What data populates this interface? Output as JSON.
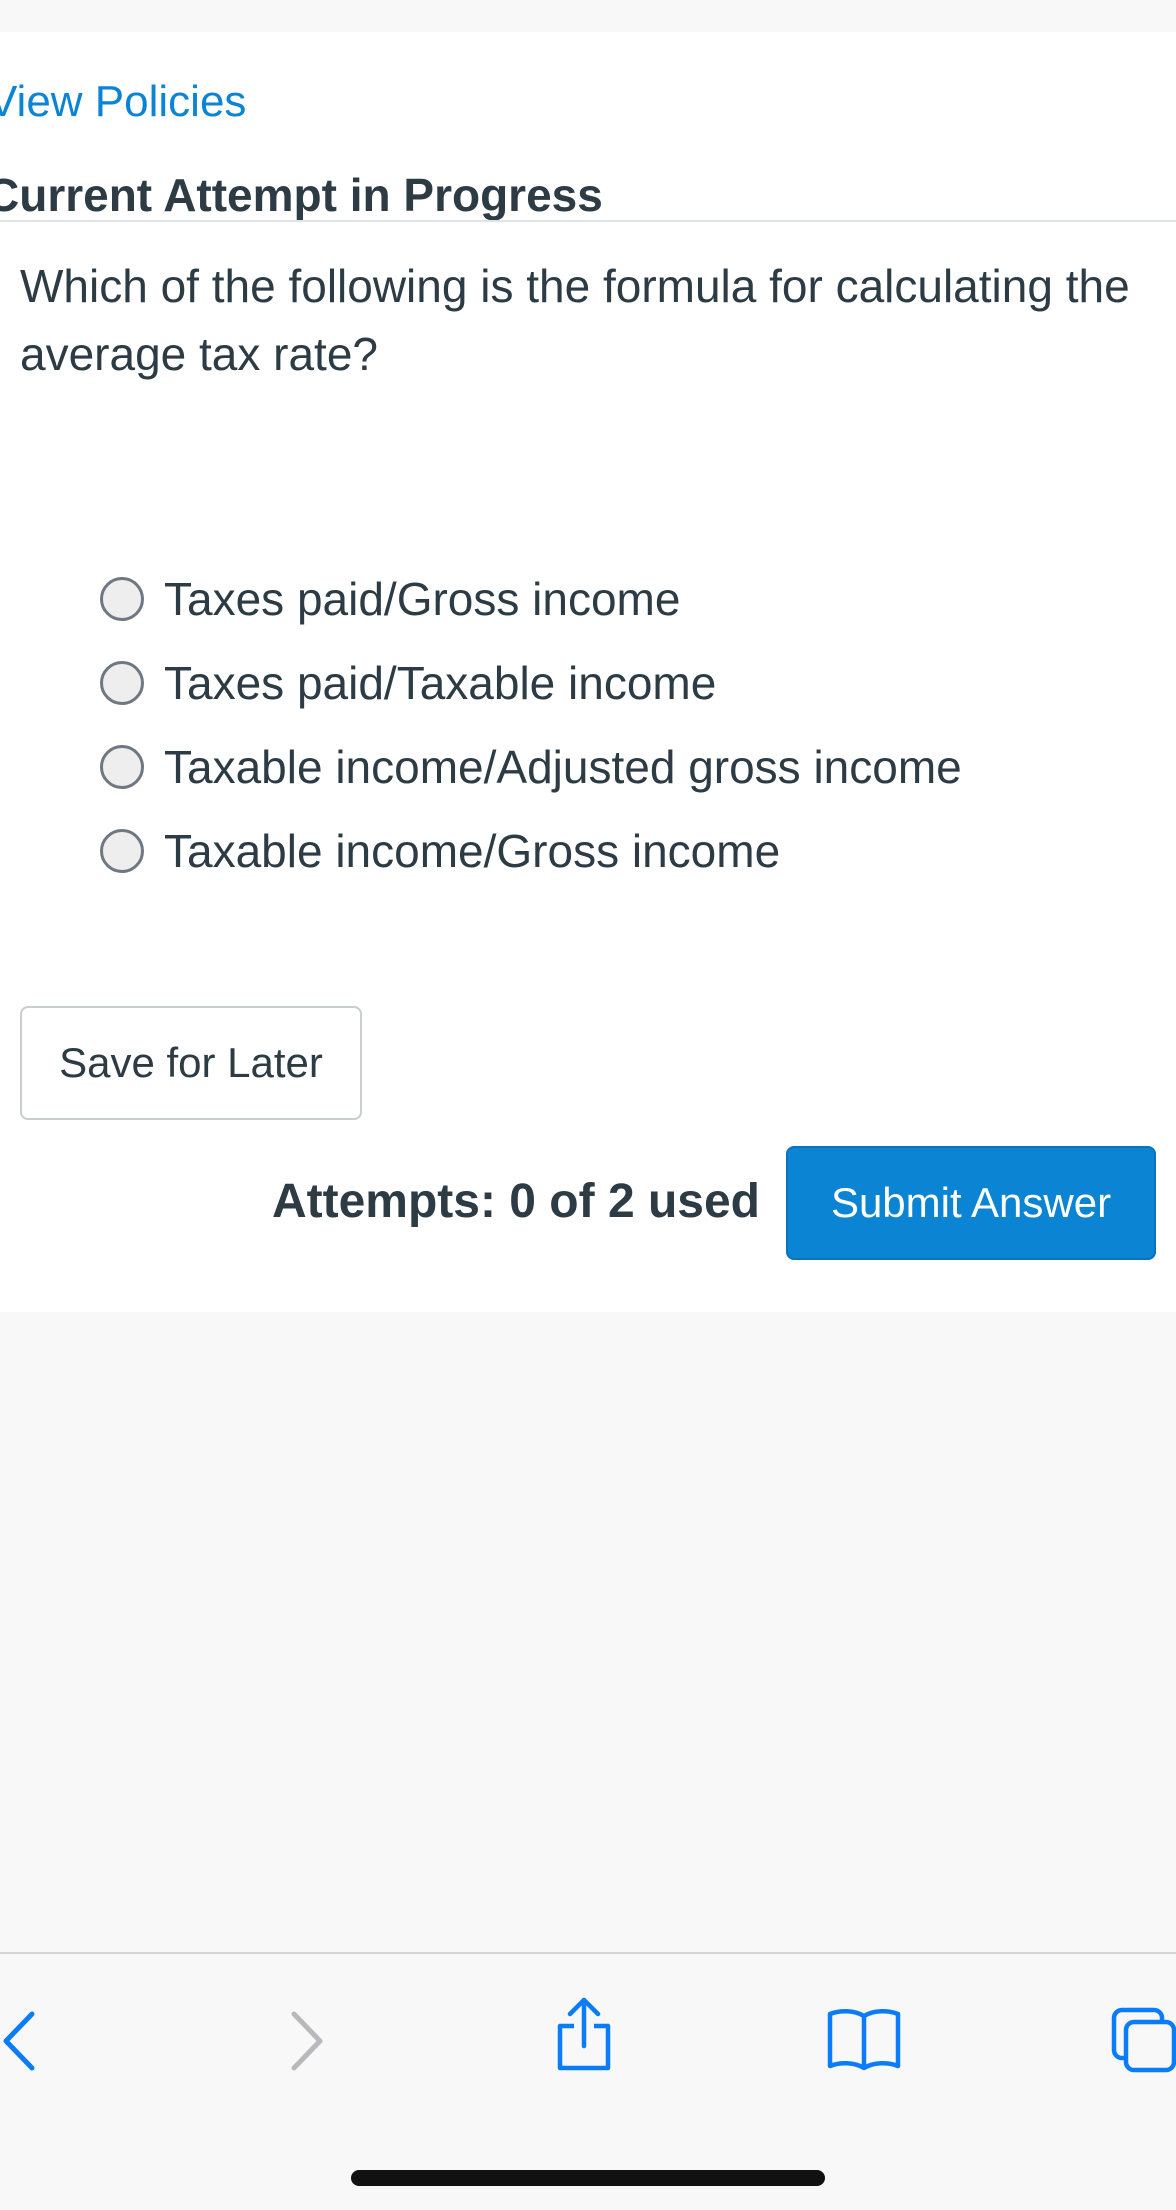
{
  "links": {
    "view_policies": "View Policies"
  },
  "header": {
    "attempt_title": "Current Attempt in Progress"
  },
  "question": {
    "text": "Which of the following is the formula for calculating the average tax rate?",
    "options": [
      "Taxes paid/Gross income",
      "Taxes paid/Taxable income",
      "Taxable income/Adjusted gross income",
      "Taxable income/Gross income"
    ]
  },
  "actions": {
    "save_label": "Save for Later",
    "attempts_text": "Attempts: 0 of 2 used",
    "submit_label": "Submit Answer"
  },
  "colors": {
    "accent": "#0b84d4",
    "text": "#2d3b45",
    "background": "#f8f8f8"
  },
  "toolbar": {
    "icons": [
      "back-icon",
      "forward-icon",
      "share-icon",
      "bookmarks-icon",
      "tabs-icon"
    ]
  }
}
